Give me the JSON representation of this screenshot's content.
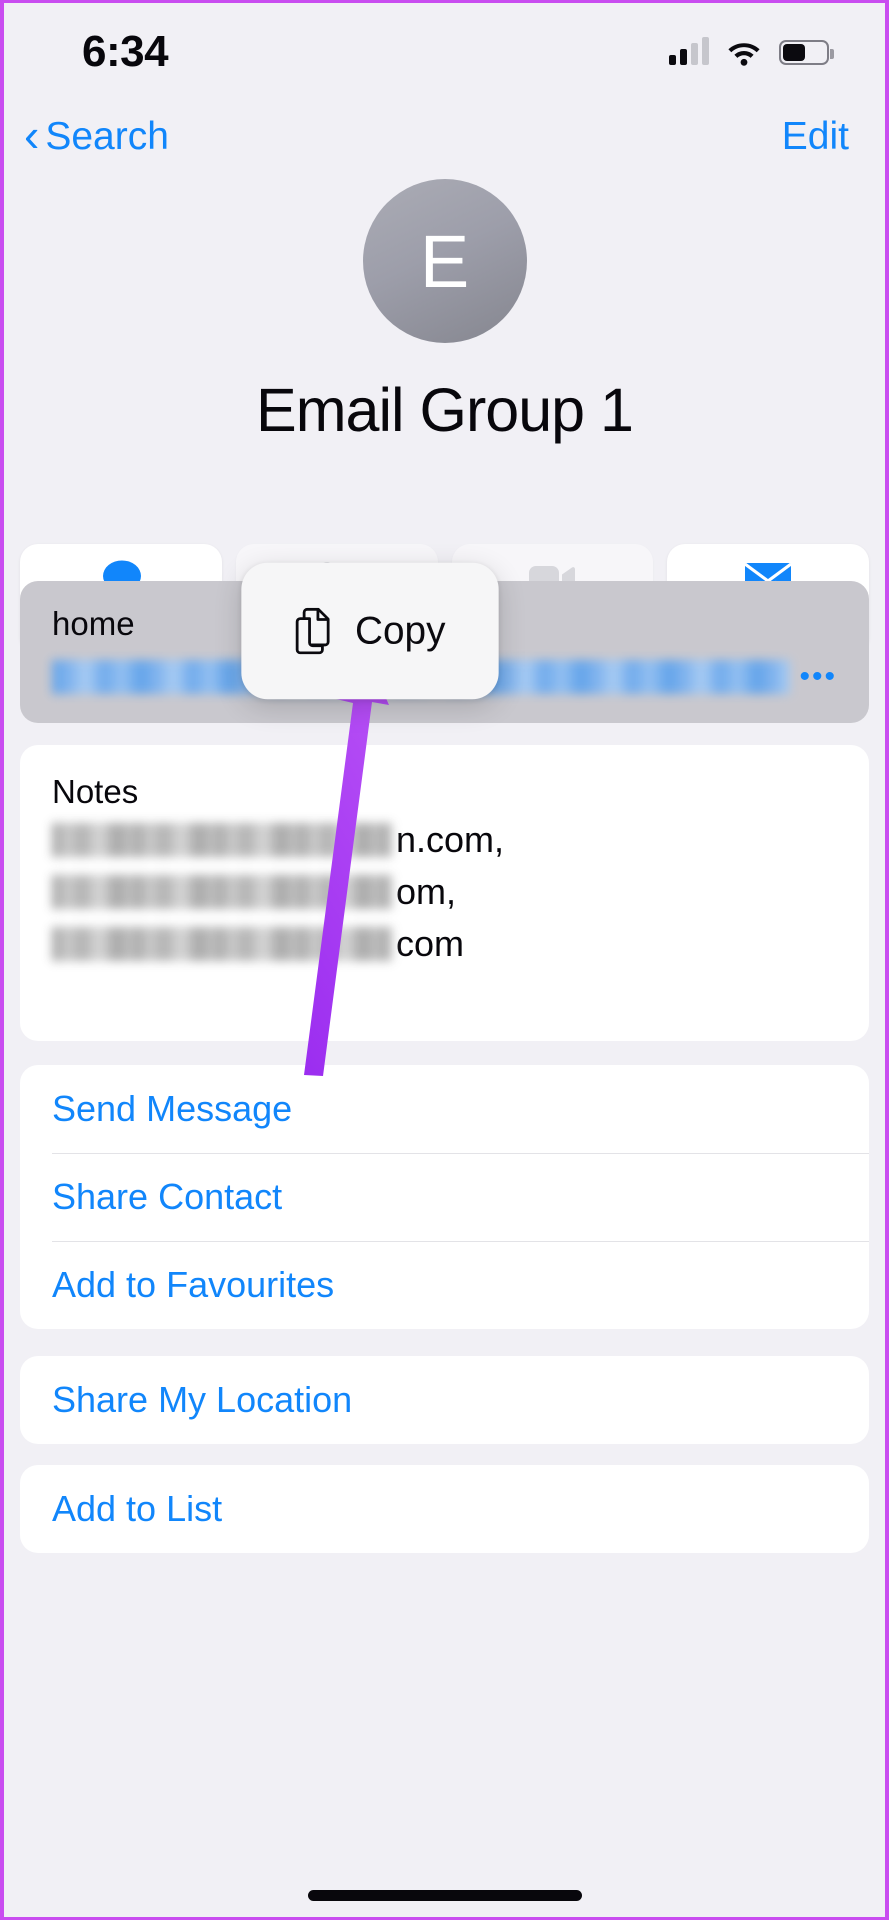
{
  "status_bar": {
    "time": "6:34",
    "signal_icon": "cellular-bars-icon",
    "wifi_icon": "wifi-icon",
    "battery_icon": "battery-icon",
    "battery_level_pct": 45
  },
  "nav_bar": {
    "back_label": "Search",
    "back_icon": "chevron-left-icon",
    "edit_label": "Edit"
  },
  "contact": {
    "avatar_initial": "E",
    "name": "Email Group 1"
  },
  "actions": [
    {
      "label": "message",
      "icon": "message-bubble-icon",
      "enabled": true
    },
    {
      "label": "call",
      "icon": "phone-icon",
      "enabled": false
    },
    {
      "label": "video",
      "icon": "video-camera-icon",
      "enabled": false
    },
    {
      "label": "mail",
      "icon": "envelope-icon",
      "enabled": true
    }
  ],
  "popup": {
    "label": "Copy",
    "icon": "copy-documents-icon"
  },
  "email_field": {
    "label": "home",
    "value_redacted": true,
    "ellipsis": "•••"
  },
  "notes": {
    "label": "Notes",
    "lines": [
      {
        "redacted": true,
        "tail": "n.com,"
      },
      {
        "redacted": true,
        "tail": "om,"
      },
      {
        "redacted": true,
        "tail": "com"
      }
    ]
  },
  "list_groups": [
    {
      "items": [
        "Send Message",
        "Share Contact",
        "Add to Favourites"
      ]
    },
    {
      "items": [
        "Share My Location"
      ]
    },
    {
      "items": [
        "Add to List"
      ]
    }
  ],
  "colors": {
    "accent_blue": "#1186fb",
    "page_bg": "#f1f0f5",
    "card_bg": "#ffffff",
    "selected_bg": "#c9c8ce",
    "arrow_purple": "#a733e8",
    "device_border": "#c94df0"
  }
}
